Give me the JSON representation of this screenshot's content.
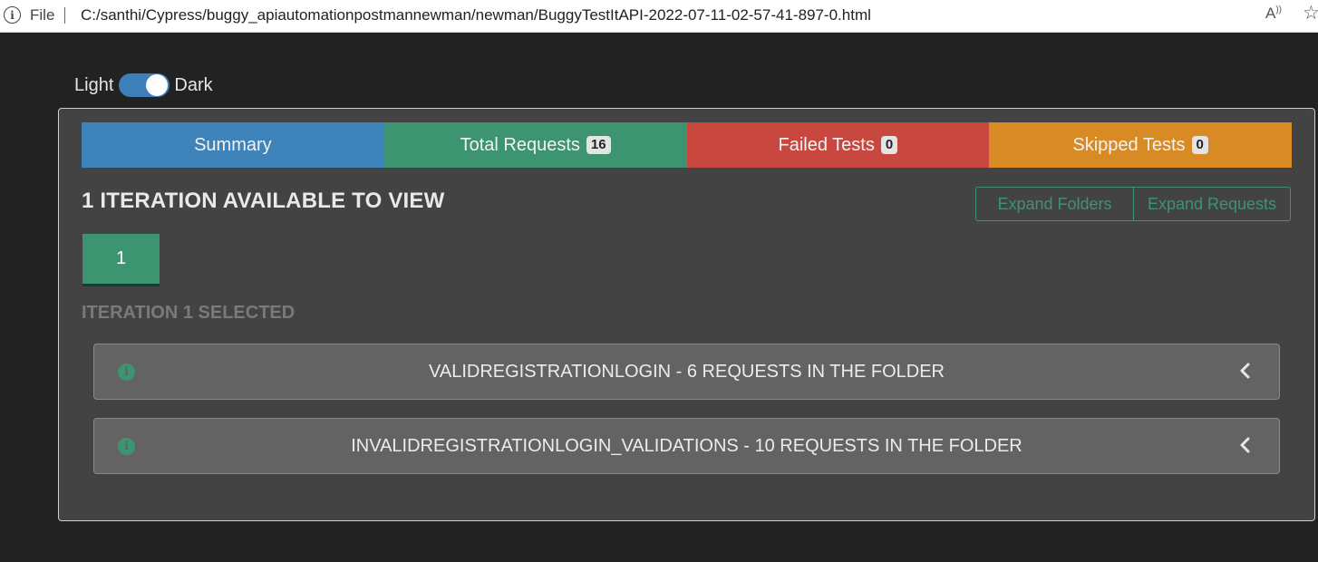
{
  "browser": {
    "file_label": "File",
    "url": "C:/santhi/Cypress/buggy_apiautomationpostmannewman/newman/BuggyTestItAPI-2022-07-11-02-57-41-897-0.html",
    "read_aloud_glyph": "A",
    "read_aloud_sup": "))",
    "favorite_glyph": "☆",
    "info_glyph": "i",
    "icons": [
      "info-icon",
      "read-aloud-icon",
      "favorite-star-icon"
    ]
  },
  "theme": {
    "light_label": "Light",
    "dark_label": "Dark",
    "dark_mode_on": true,
    "accent": "#3d7fb8"
  },
  "tabs": [
    {
      "label": "Summary",
      "badge": null,
      "color": "#3f83bb"
    },
    {
      "label": "Total Requests",
      "badge": "16",
      "color": "#3c9470"
    },
    {
      "label": "Failed Tests",
      "badge": "0",
      "color": "#c8483f"
    },
    {
      "label": "Skipped Tests",
      "badge": "0",
      "color": "#d88b24"
    }
  ],
  "iterations": {
    "heading": "1 ITERATION AVAILABLE TO VIEW",
    "expand_folders_label": "Expand Folders",
    "expand_requests_label": "Expand Requests",
    "items": [
      "1"
    ],
    "selected_label": "ITERATION 1 SELECTED"
  },
  "folders": [
    {
      "title": "VALIDREGISTRATIONLOGIN - 6 REQUESTS IN THE FOLDER",
      "icon": "info-circle-icon",
      "status_color": "#3c9470"
    },
    {
      "title": "INVALIDREGISTRATIONLOGIN_VALIDATIONS - 10 REQUESTS IN THE FOLDER",
      "icon": "info-circle-icon",
      "status_color": "#3c9470"
    }
  ]
}
